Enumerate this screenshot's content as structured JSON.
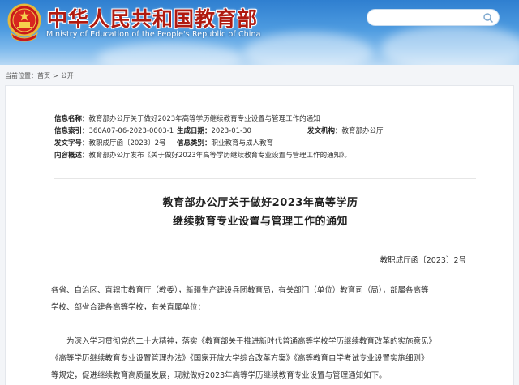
{
  "header": {
    "site_title": "中华人民共和国教育部",
    "site_subtitle": "Ministry of Education of the People's Republic of China",
    "colors": {
      "title_red": "#b01a10",
      "sky_blue": "#3a88d6"
    }
  },
  "breadcrumb": {
    "prefix": "当前位置：",
    "items": [
      "首页",
      "公开"
    ],
    "separator": ">"
  },
  "meta": {
    "name_label": "信息名称：",
    "name_value": "教育部办公厅关于做好2023年高等学历继续教育专业设置与管理工作的通知",
    "index_label": "信息索引：",
    "index_value": "360A07-06-2023-0003-1",
    "date_label": "生成日期：",
    "date_value": "2023-01-30",
    "issuer_label": "发文机构：",
    "issuer_value": "教育部办公厅",
    "docno_label": "发文字号：",
    "docno_value": "教职成厅函〔2023〕2号",
    "category_label": "信息类别：",
    "category_value": "职业教育与成人教育",
    "summary_label": "内容概述：",
    "summary_value": "教育部办公厅发布《关于做好2023年高等学历继续教育专业设置与管理工作的通知》。"
  },
  "document": {
    "title_line1": "教育部办公厅关于做好2023年高等学历",
    "title_line2": "继续教育专业设置与管理工作的通知",
    "number": "教职成厅函〔2023〕2号",
    "addressee_line1": "各省、自治区、直辖市教育厅（教委），新疆生产建设兵团教育局，有关部门（单位）教育司（局），部属各高等",
    "addressee_line2": "学校、部省合建各高等学校，有关直属单位：",
    "body_line1": "为深入学习贯彻党的二十大精神，落实《教育部关于推进新时代普通高等学校学历继续教育改革的实施意见》",
    "body_line2": "《高等学历继续教育专业设置管理办法》《国家开放大学综合改革方案》《高等教育自学考试专业设置实施细则》",
    "body_line3": "等规定，促进继续教育高质量发展，现就做好2023年高等学历继续教育专业设置与管理通知如下。"
  }
}
